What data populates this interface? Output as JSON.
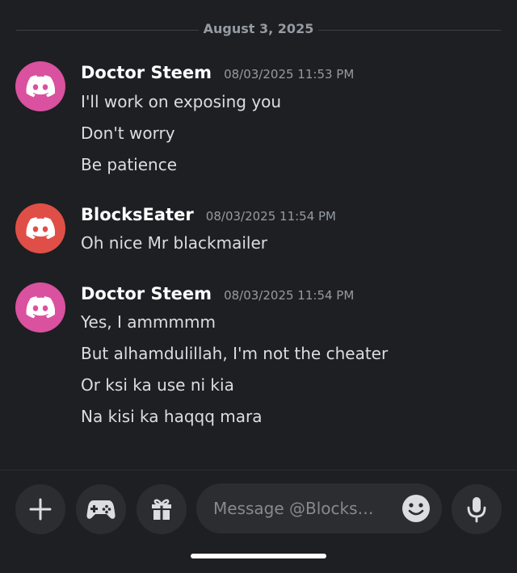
{
  "date_divider": "August 3, 2025",
  "messages": [
    {
      "author": "Doctor Steem",
      "timestamp": "08/03/2025 11:53 PM",
      "avatar_color": "#d9519f",
      "lines": [
        "I'll work on exposing you",
        "Don't worry",
        "Be patience"
      ]
    },
    {
      "author": "BlocksEater",
      "timestamp": "08/03/2025 11:54 PM",
      "avatar_color": "#df4f47",
      "lines": [
        "Oh nice Mr blackmailer"
      ]
    },
    {
      "author": "Doctor Steem",
      "timestamp": "08/03/2025 11:54 PM",
      "avatar_color": "#d9519f",
      "lines": [
        "Yes, I ammmmm",
        "But alhamdulillah, I'm not the cheater",
        "Or ksi ka use ni kia",
        "Na kisi ka haqqq mara"
      ]
    }
  ],
  "composer": {
    "placeholder": "Message @Blocks…",
    "buttons": [
      "plus-icon",
      "gamepad-icon",
      "gift-icon",
      "emoji-icon",
      "microphone-icon"
    ]
  },
  "colors": {
    "background": "#1e1f22",
    "button_bg": "#2b2d31",
    "muted_text": "#949ba4"
  }
}
